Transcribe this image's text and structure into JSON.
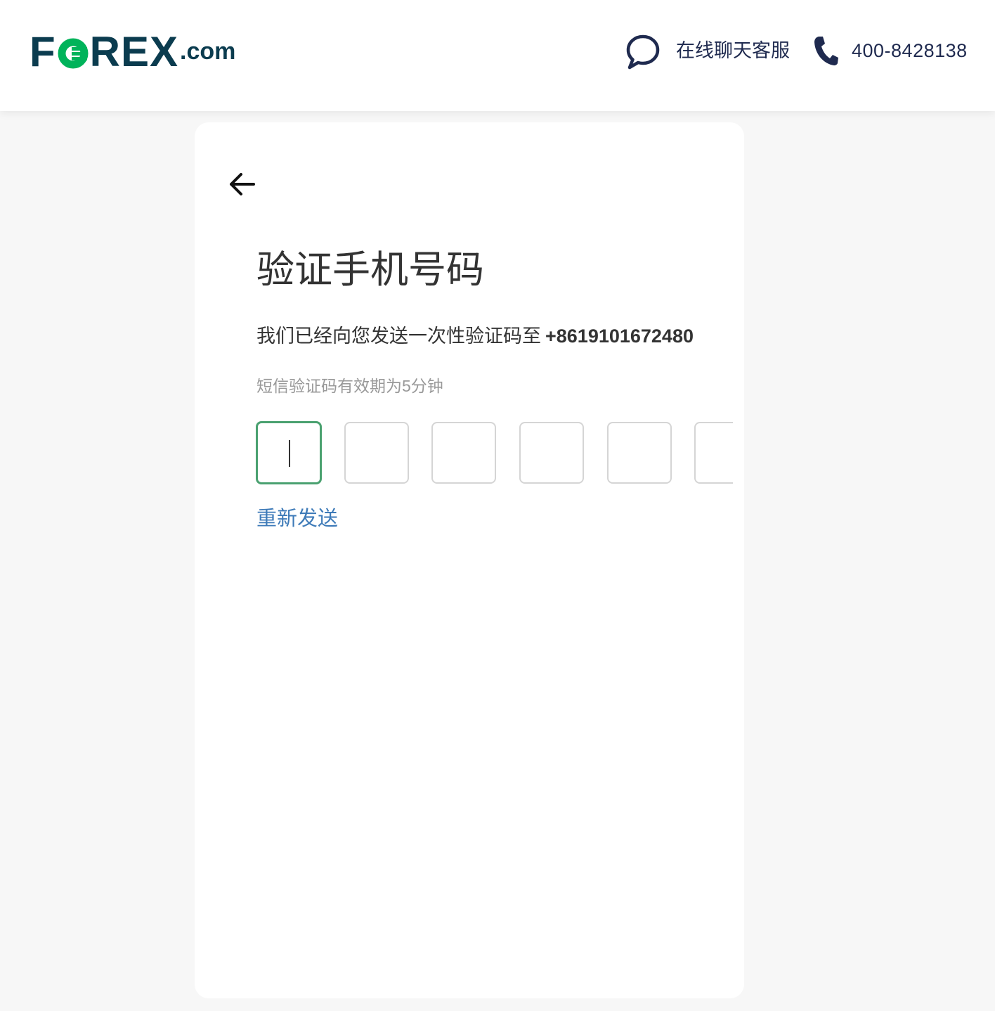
{
  "header": {
    "logo": {
      "f": "F",
      "rex": "REX",
      "dotcom": ".com"
    },
    "chat_label": "在线聊天客服",
    "phone_label": "400-8428138"
  },
  "verify": {
    "title": "验证手机号码",
    "sent_text": "我们已经向您发送一次性验证码至",
    "phone_number": "+8619101672480",
    "validity_text": "短信验证码有效期为5分钟",
    "code_digits": [
      "",
      "",
      "",
      "",
      "",
      ""
    ],
    "resend_label": "重新发送"
  },
  "colors": {
    "brand_dark": "#0b3c4f",
    "brand_green": "#00b35a",
    "active_border": "#4aa170",
    "link": "#3d7ab8",
    "nav_text": "#1f2a4f"
  },
  "icons": {
    "chat": "chat-bubble-icon",
    "phone": "phone-icon",
    "back": "arrow-left-icon"
  }
}
